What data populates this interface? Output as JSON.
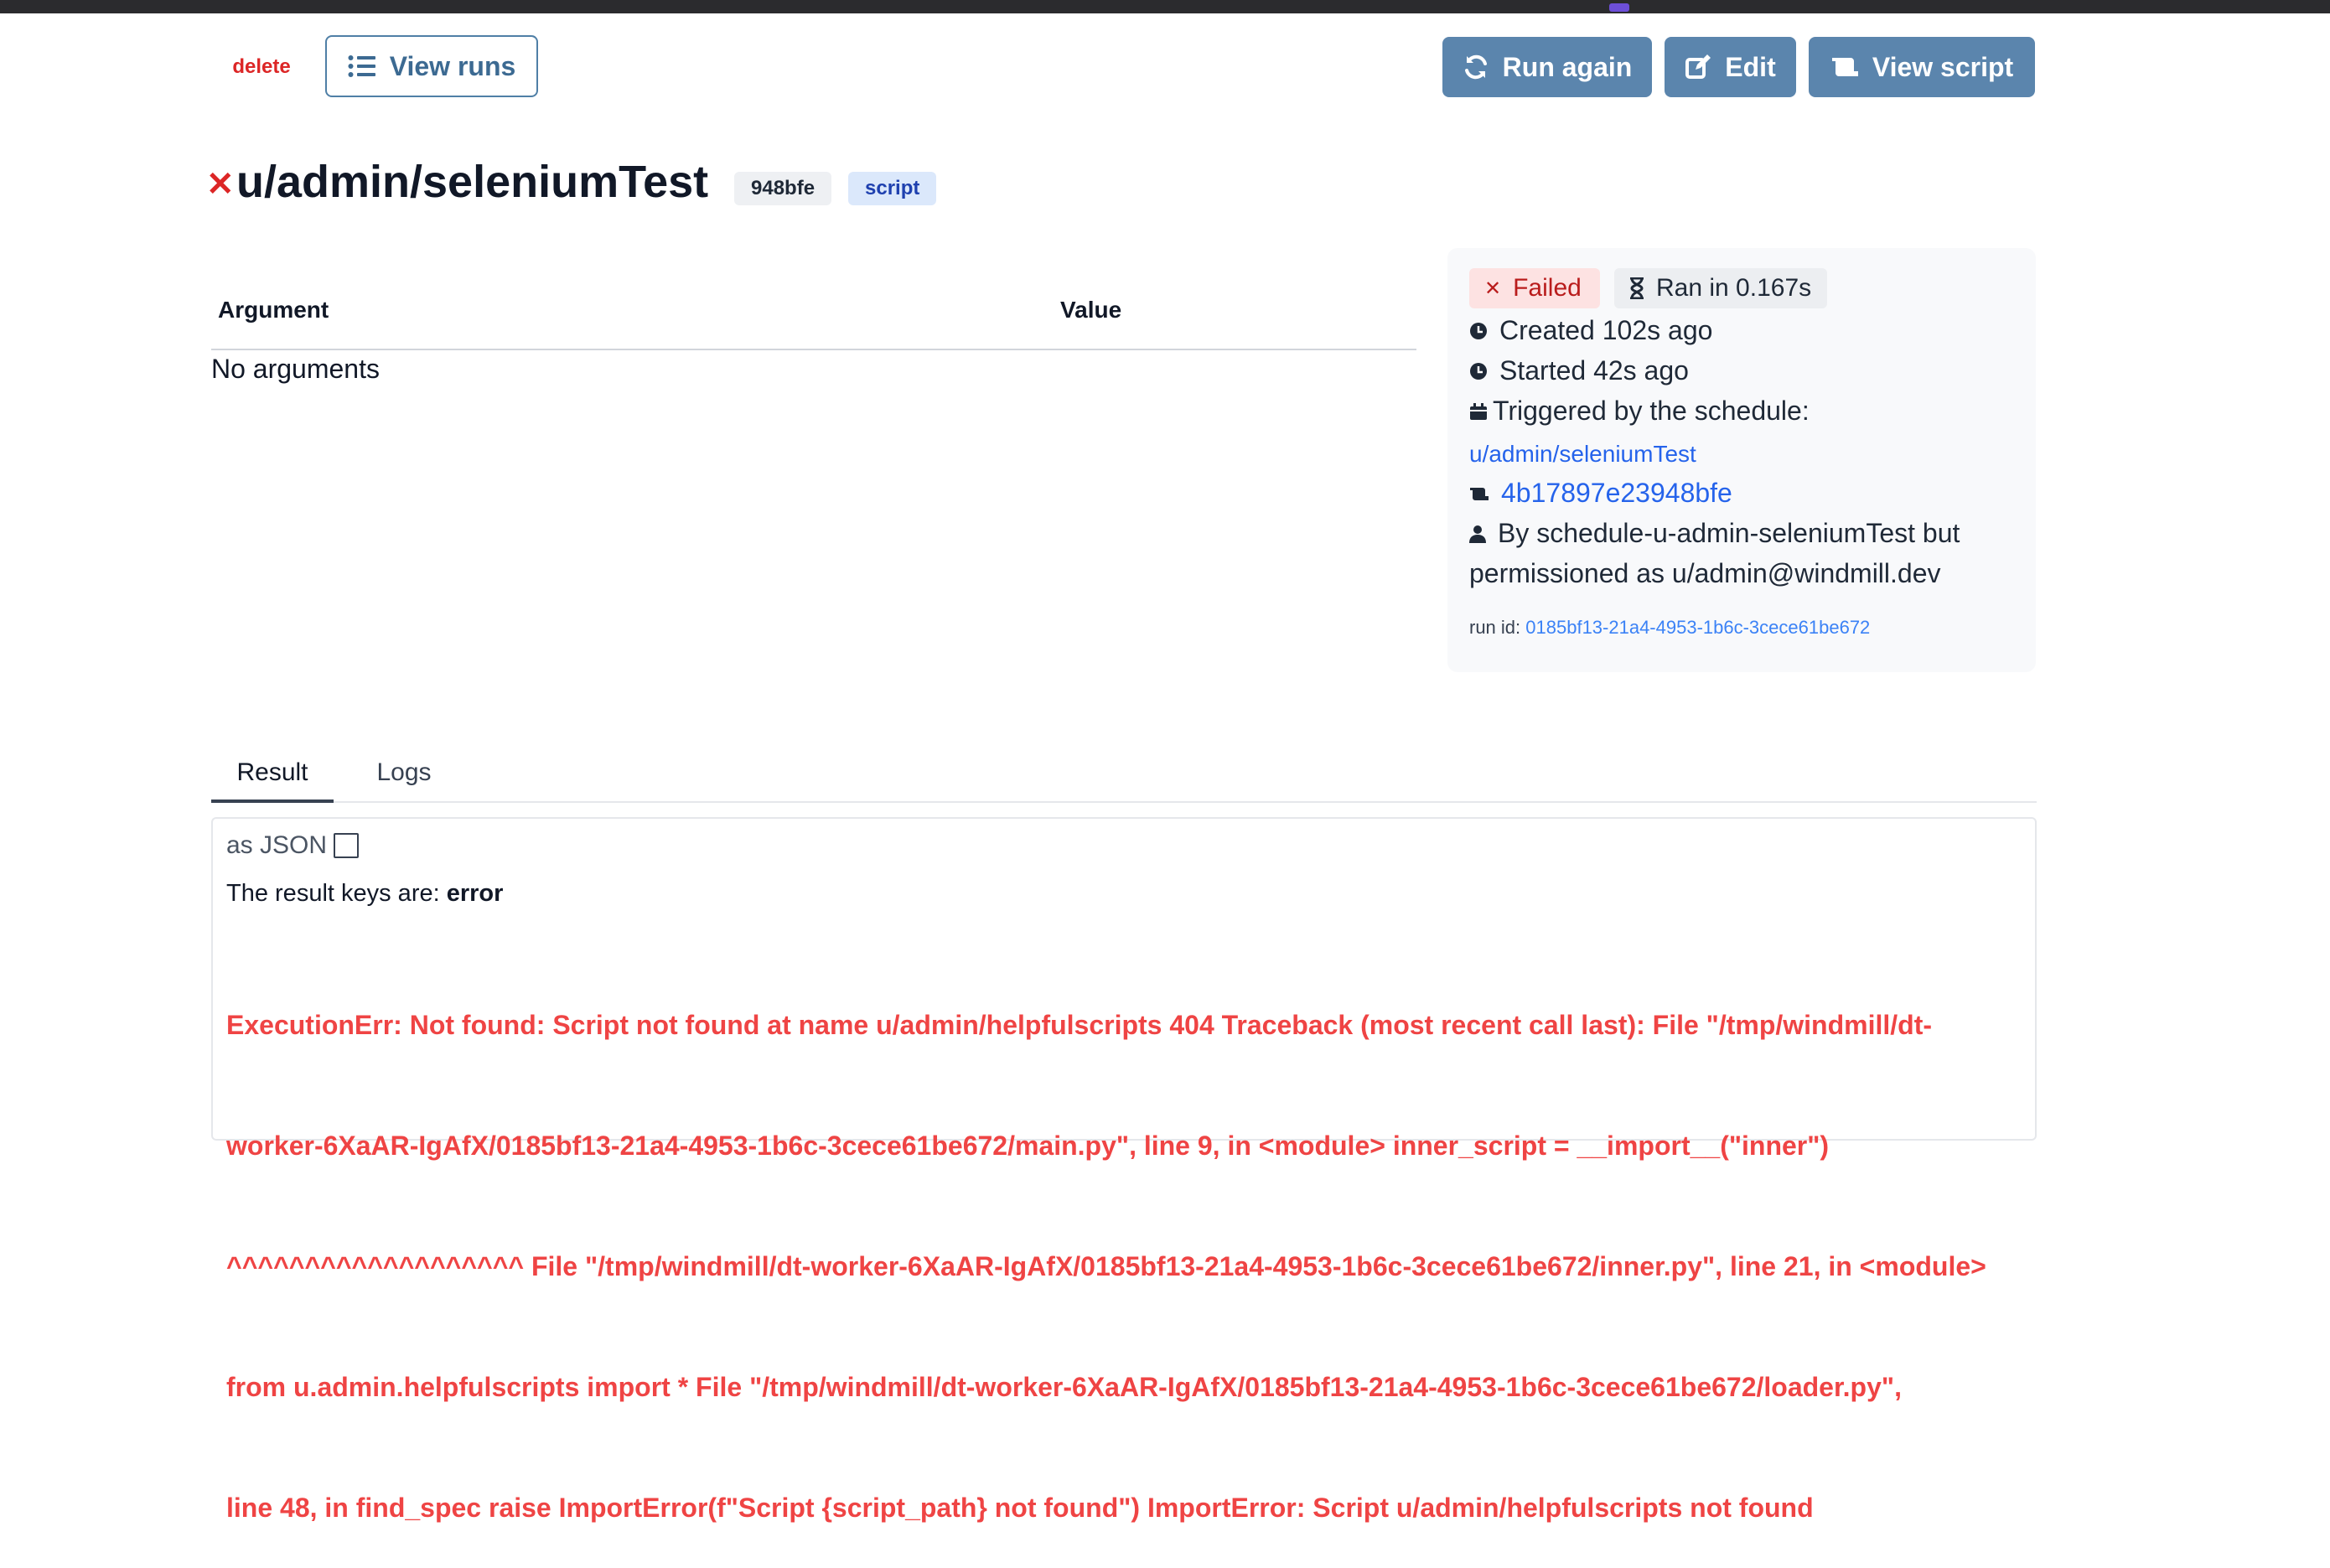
{
  "header": {
    "delete_label": "delete",
    "view_runs_label": "View runs",
    "run_again_label": "Run again",
    "edit_label": "Edit",
    "view_script_label": "View script"
  },
  "job": {
    "path": "u/admin/seleniumTest",
    "hash": "948bfe",
    "kind": "script",
    "status_icon": "x-icon"
  },
  "arguments": {
    "col_argument": "Argument",
    "col_value": "Value",
    "empty": "No arguments"
  },
  "info": {
    "status": "Failed",
    "duration": "Ran in 0.167s",
    "created": "Created 102s ago",
    "started": "Started 42s ago",
    "triggered_label": "Triggered by the schedule:",
    "schedule_link": "u/admin/seleniumTest",
    "script_hash_link": "4b17897e23948bfe",
    "permissioned_line1": "By schedule-u-admin-seleniumTest but",
    "permissioned_line2": "permissioned as u/admin@windmill.dev",
    "run_id_label": "run id:",
    "run_id": "0185bf13-21a4-4953-1b6c-3cece61be672"
  },
  "tabs": [
    {
      "label": "Result",
      "active": true
    },
    {
      "label": "Logs",
      "active": false
    }
  ],
  "result": {
    "as_json_label": "as JSON",
    "keys_prefix": "The result keys are:",
    "keys": "error",
    "error_lines": [
      "ExecutionErr: Not found: Script not found at name u/admin/helpfulscripts 404 Traceback (most recent call last): File \"/tmp/windmill/dt-",
      "worker-6XaAR-IgAfX/0185bf13-21a4-4953-1b6c-3cece61be672/main.py\", line 9, in <module> inner_script = __import__(\"inner\")",
      "^^^^^^^^^^^^^^^^^^^ File \"/tmp/windmill/dt-worker-6XaAR-IgAfX/0185bf13-21a4-4953-1b6c-3cece61be672/inner.py\", line 21, in <module>",
      "from u.admin.helpfulscripts import * File \"/tmp/windmill/dt-worker-6XaAR-IgAfX/0185bf13-21a4-4953-1b6c-3cece61be672/loader.py\",",
      "line 48, in find_spec raise ImportError(f\"Script {script_path} not found\") ImportError: Script u/admin/helpfulscripts not found"
    ]
  },
  "colors": {
    "primary_button": "#5b85ad",
    "error": "#ef4444",
    "link": "#2563eb"
  }
}
